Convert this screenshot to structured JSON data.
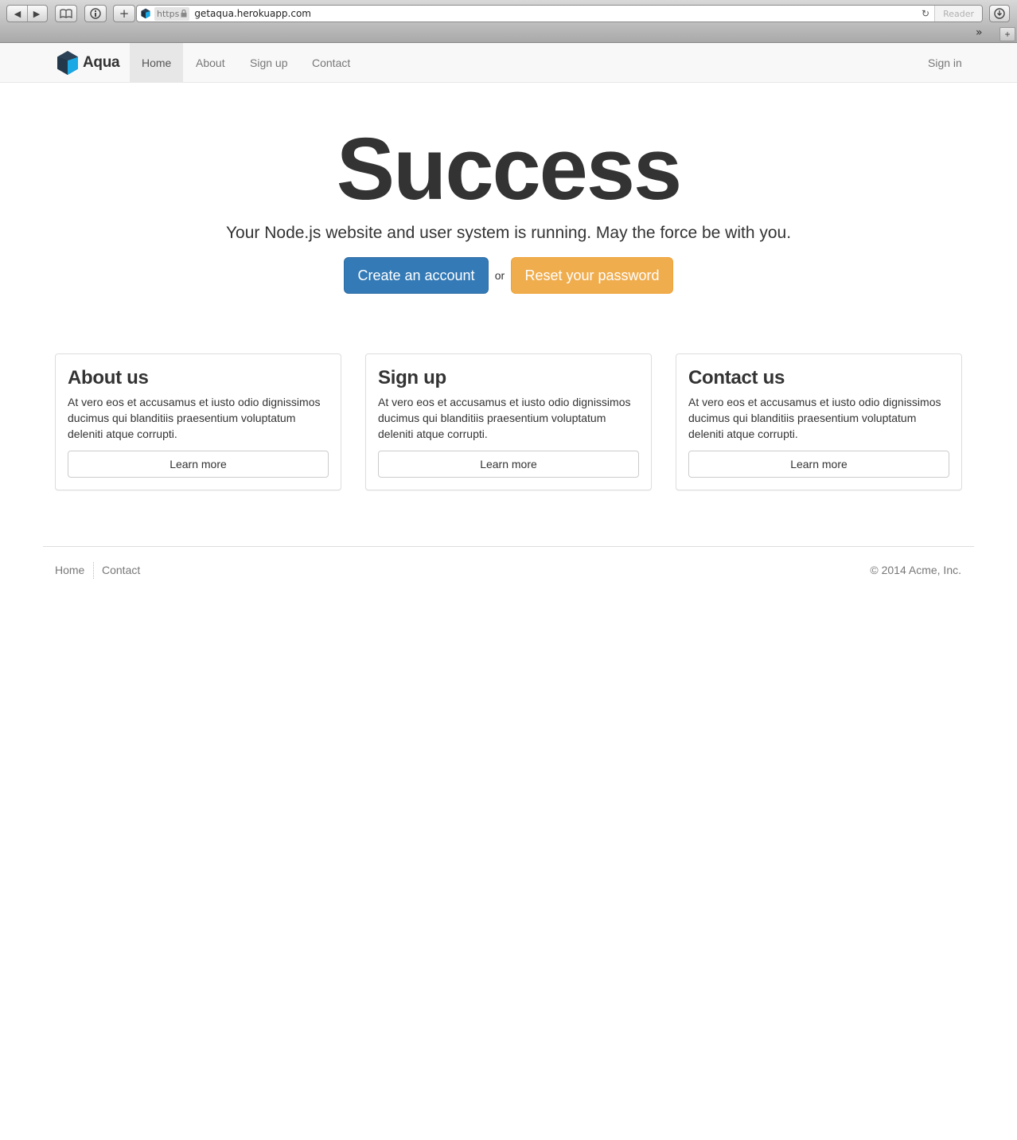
{
  "browser": {
    "url_scheme": "https",
    "url": "getaqua.herokuapp.com",
    "reader_label": "Reader",
    "overflow_glyph": "»",
    "new_tab_glyph": "+"
  },
  "navbar": {
    "brand": "Aqua",
    "items": [
      {
        "label": "Home",
        "active": true
      },
      {
        "label": "About"
      },
      {
        "label": "Sign up"
      },
      {
        "label": "Contact"
      }
    ],
    "signin": "Sign in"
  },
  "hero": {
    "title": "Success",
    "subtitle": "Your Node.js website and user system is running. May the force be with you.",
    "primary_button": "Create an account",
    "or_text": "or",
    "warning_button": "Reset your password"
  },
  "panels": [
    {
      "title": "About us",
      "body": "At vero eos et accusamus et iusto odio dignissimos ducimus qui blanditiis praesentium voluptatum deleniti atque corrupti.",
      "button": "Learn more"
    },
    {
      "title": "Sign up",
      "body": "At vero eos et accusamus et iusto odio dignissimos ducimus qui blanditiis praesentium voluptatum deleniti atque corrupti.",
      "button": "Learn more"
    },
    {
      "title": "Contact us",
      "body": "At vero eos et accusamus et iusto odio dignissimos ducimus qui blanditiis praesentium voluptatum deleniti atque corrupti.",
      "button": "Learn more"
    }
  ],
  "footer": {
    "links": [
      "Home",
      "Contact"
    ],
    "copyright": "© 2014 Acme, Inc."
  },
  "colors": {
    "primary": "#337ab7",
    "warning": "#f0ad4e",
    "brand_dark": "#1f3040",
    "brand_aqua": "#19a9e5"
  }
}
